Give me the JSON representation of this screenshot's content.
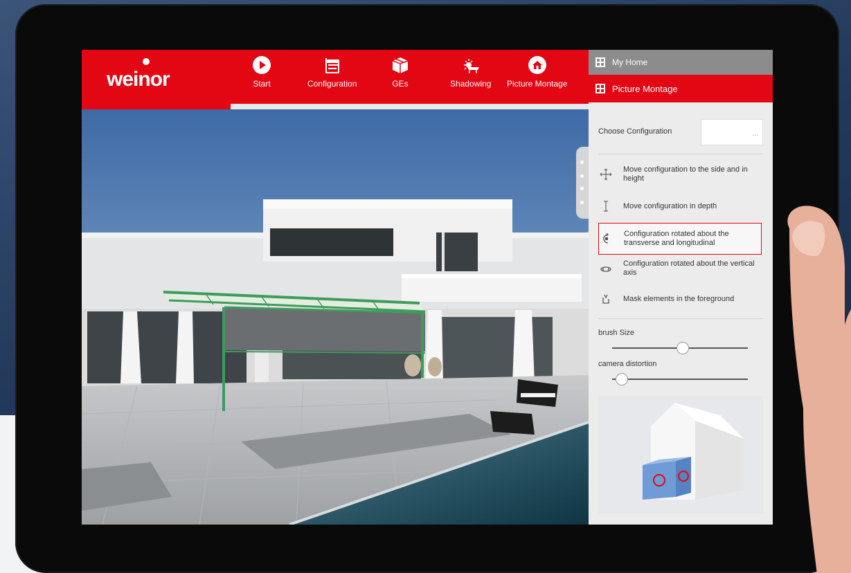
{
  "app": {
    "logo_text": "weinor",
    "brand_color": "#e30613"
  },
  "nav": [
    {
      "label": "Start",
      "icon": "play-icon"
    },
    {
      "label": "Configuration",
      "icon": "pergola-icon"
    },
    {
      "label": "GEs",
      "icon": "box-icon"
    },
    {
      "label": "Shadowing",
      "icon": "sun-icon"
    },
    {
      "label": "Picture Montage",
      "icon": "home-icon"
    }
  ],
  "panel": {
    "my_home_label": "My Home",
    "picture_montage_label": "Picture Montage",
    "choose_config_label": "Choose Configuration",
    "choose_config_value": "...",
    "tools": [
      {
        "label": "Move configuration to the side and in height",
        "icon": "move-arrows-icon",
        "active": false
      },
      {
        "label": "Move configuration in depth",
        "icon": "depth-icon",
        "active": false
      },
      {
        "label": "Configuration rotated about the transverse and longitudinal",
        "icon": "rotate-axis-icon",
        "active": true
      },
      {
        "label": "Configuration rotated about the vertical axis",
        "icon": "rotate-vertical-icon",
        "active": false
      },
      {
        "label": "Mask elements in the foreground",
        "icon": "mask-icon",
        "active": false
      }
    ],
    "brush_size_label": "brush Size",
    "brush_size_value": 0.52,
    "camera_distortion_label": "camera distortion",
    "camera_distortion_value": 0.03
  }
}
